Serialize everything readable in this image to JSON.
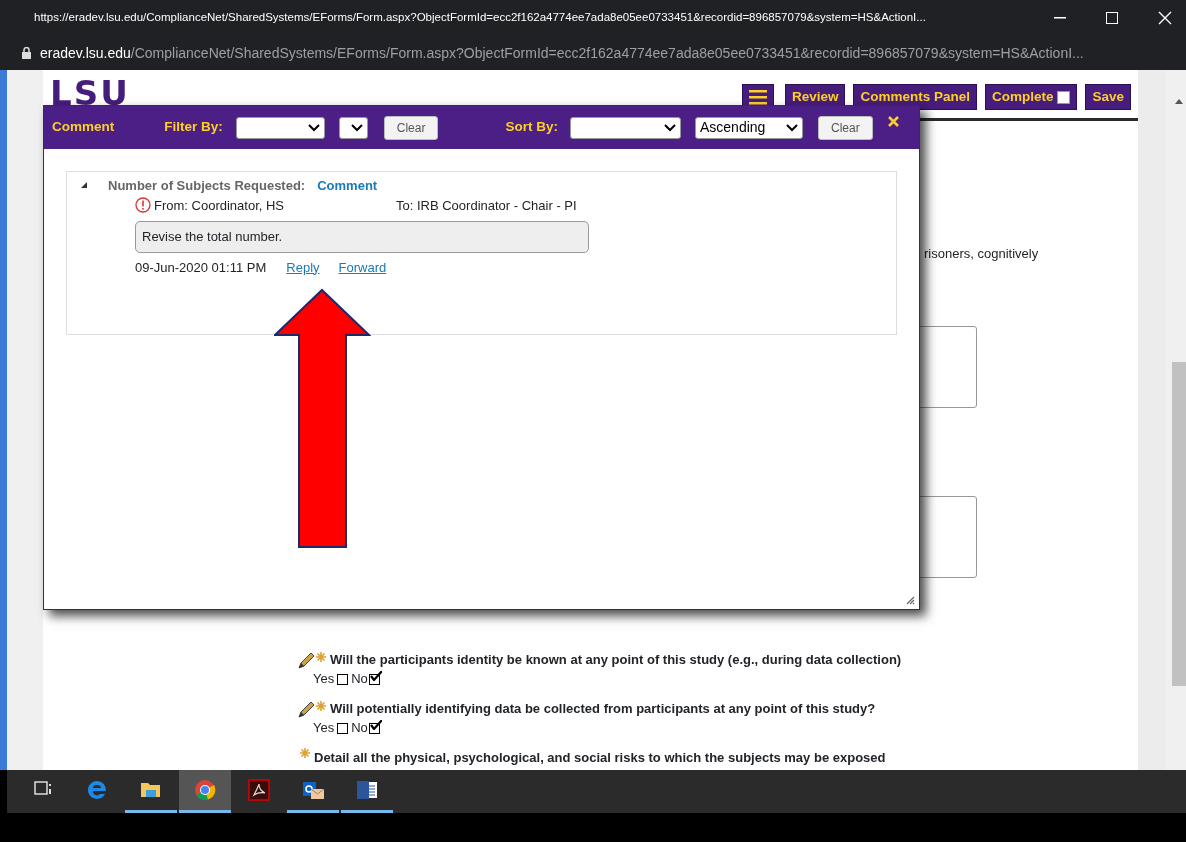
{
  "browser": {
    "title": "https://eradev.lsu.edu/ComplianceNet/SharedSystems/EForms/Form.aspx?ObjectFormId=ecc2f162a4774ee7ada8e05ee0733451&recordid=896857079&system=HS&ActionI...",
    "address_host": "eradev.lsu.edu",
    "address_path": "/ComplianceNet/SharedSystems/EForms/Form.aspx?ObjectFormId=ecc2f162a4774ee7ada8e05ee0733451&recordid=896857079&system=HS&ActionI..."
  },
  "header": {
    "logo": "LSU",
    "buttons": [
      {
        "kind": "menu"
      },
      {
        "kind": "plain",
        "label": "Review"
      },
      {
        "kind": "plain",
        "label": "Comments Panel"
      },
      {
        "kind": "checkbox",
        "label": "Complete",
        "checked": false
      },
      {
        "kind": "plain",
        "label": "Save"
      }
    ]
  },
  "background_text": "risoners, cognitively",
  "questions": [
    {
      "text": "Will the participants identity be known at any point of this study (e.g., during data collection)",
      "kind": "pencil",
      "options": [
        {
          "label": "Yes",
          "checked": false
        },
        {
          "label": "No",
          "checked": true
        }
      ]
    },
    {
      "text": "Will potentially identifying data be collected from participants at any point of this study?",
      "kind": "pencil",
      "options": [
        {
          "label": "Yes",
          "checked": false
        },
        {
          "label": "No",
          "checked": true
        }
      ]
    },
    {
      "text": "Detail all the physical, psychological, and social risks to which the subjects may be exposed",
      "kind": "plain"
    }
  ],
  "comment_dialog": {
    "title": "Comment",
    "filter_label": "Filter By:",
    "sort_label": "Sort By:",
    "sort_order": "Ascending",
    "clear_buttons": [
      "Clear",
      "Clear"
    ],
    "thread": {
      "expanded": true,
      "field": "Number of Subjects Requested:",
      "link": "Comment",
      "from": "From: Coordinator, HS",
      "to": "To: IRB Coordinator - Chair - PI",
      "message": "Revise the total number.",
      "timestamp": "09-Jun-2020 01:11 PM",
      "actions": [
        "Reply",
        "Forward"
      ]
    }
  },
  "taskbar": {
    "apps": [
      {
        "kind": "taskview",
        "open": false,
        "active": false
      },
      {
        "kind": "edge",
        "open": false,
        "active": false
      },
      {
        "kind": "folder",
        "open": true,
        "active": false
      },
      {
        "kind": "chrome",
        "open": true,
        "active": true
      },
      {
        "kind": "pdf",
        "open": false,
        "active": false
      },
      {
        "kind": "mail",
        "open": true,
        "active": false
      },
      {
        "kind": "word",
        "open": true,
        "active": false
      }
    ]
  }
}
